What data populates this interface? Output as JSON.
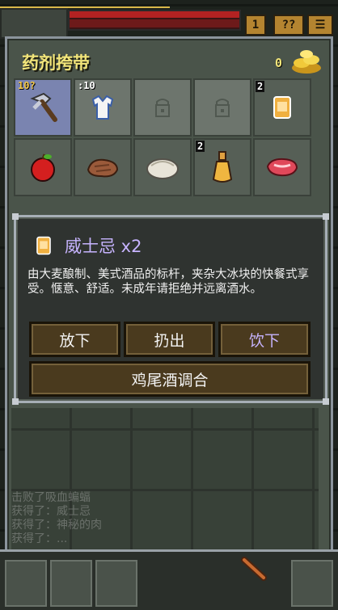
{
  "hud": {
    "buttons": [
      "1",
      "??",
      "☰"
    ]
  },
  "backpack": {
    "title": "药剂挎带",
    "gold": "0",
    "slots": [
      {
        "icon": "pickaxe-icon",
        "badge": "10?",
        "state": "equipped"
      },
      {
        "icon": "shirt-icon",
        "badge": ":10",
        "state": "dim"
      },
      {
        "icon": "empty-slot-lock-icon",
        "badge": "",
        "state": "dim"
      },
      {
        "icon": "empty-slot-lock-icon",
        "badge": "",
        "state": "dim"
      },
      {
        "icon": "whiskey-icon",
        "badge": "2",
        "state": "normal"
      },
      {
        "icon": "apple-icon",
        "badge": "",
        "state": "normal"
      },
      {
        "icon": "meat-chunk-icon",
        "badge": "",
        "state": "normal"
      },
      {
        "icon": "pasty-icon",
        "badge": "",
        "state": "normal"
      },
      {
        "icon": "potion-bottle-icon",
        "badge": "2",
        "state": "normal"
      },
      {
        "icon": "raw-steak-icon",
        "badge": "",
        "state": "normal"
      }
    ]
  },
  "popup": {
    "title": "威士忌 x2",
    "description": "由大麦酿制、美式酒品的标杆，夹杂大冰块的快餐式享受。惬意、舒适。未成年请拒绝并远离酒水。",
    "buttons": {
      "drop": "放下",
      "throw": "扔出",
      "drink": "饮下",
      "cocktail": "鸡尾酒调合"
    }
  },
  "log": [
    "击败了吸血蝙蝠",
    "获得了：威士忌",
    "获得了：神秘的肉",
    "获得了：..."
  ]
}
